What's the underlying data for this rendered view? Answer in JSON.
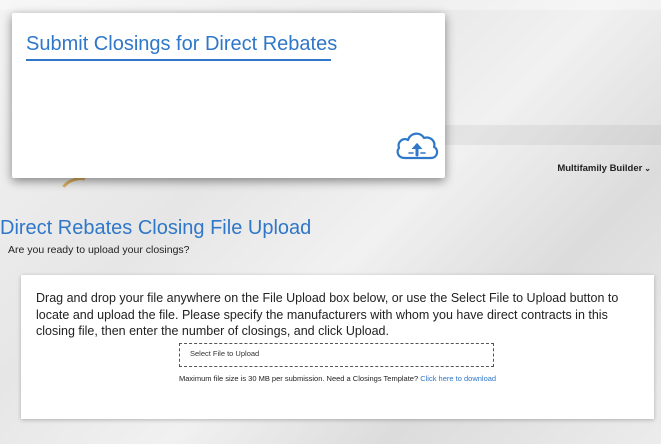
{
  "callout": {
    "title": "Submit Closings for Direct Rebates",
    "icon": "cloud-upload-icon"
  },
  "header": {
    "role_dropdown": {
      "selected": "Multifamily Builder",
      "icon": "chevron-down-icon"
    }
  },
  "main": {
    "title": "Direct Rebates Closing File Upload",
    "subtitle": "Are you ready to upload your closings?",
    "upload_panel": {
      "instructions": "Drag and drop your file anywhere on the File Upload box below, or use the Select File to Upload button to locate and upload the file. Please specify the manufacturers with whom you have direct contracts in this closing file, then enter the number of closings, and click Upload.",
      "select_button_label": "Select File to Upload",
      "note_text": "Maximum file size is 30 MB per submission. Need a Closings Template?",
      "template_link_label": "Click here to download"
    }
  },
  "colors": {
    "accent": "#2f77c8",
    "text": "#222222"
  }
}
